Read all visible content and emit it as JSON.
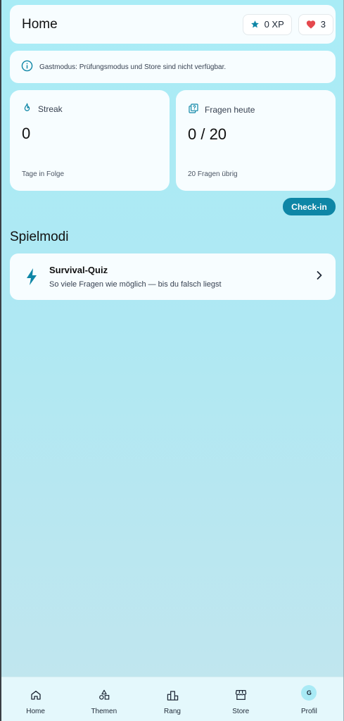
{
  "header": {
    "title": "Home",
    "xp_label": "0 XP",
    "lives_count": "3"
  },
  "notice": {
    "text": "Gastmodus: Prüfungsmodus und Store sind nicht verfügbar."
  },
  "stats": {
    "streak": {
      "label": "Streak",
      "value": "0",
      "footer": "Tage in Folge"
    },
    "questions_today": {
      "label": "Fragen heute",
      "value": "0 / 20",
      "footer": "20 Fragen übrig"
    }
  },
  "checkin_label": "Check-in",
  "modes": {
    "section_title": "Spielmodi",
    "items": [
      {
        "title": "Survival-Quiz",
        "subtitle": "So viele Fragen wie möglich — bis du falsch liegst",
        "icon": "lightning-icon"
      }
    ]
  },
  "nav": {
    "items": [
      {
        "label": "Home",
        "icon": "home-icon"
      },
      {
        "label": "Themen",
        "icon": "shapes-icon"
      },
      {
        "label": "Rang",
        "icon": "podium-icon"
      },
      {
        "label": "Store",
        "icon": "store-icon"
      },
      {
        "label": "Profil",
        "icon": "avatar"
      }
    ],
    "avatar_initial": "G"
  },
  "colors": {
    "accent": "#0e86a6",
    "heart": "#e5484d",
    "star": "#0e86a6"
  }
}
